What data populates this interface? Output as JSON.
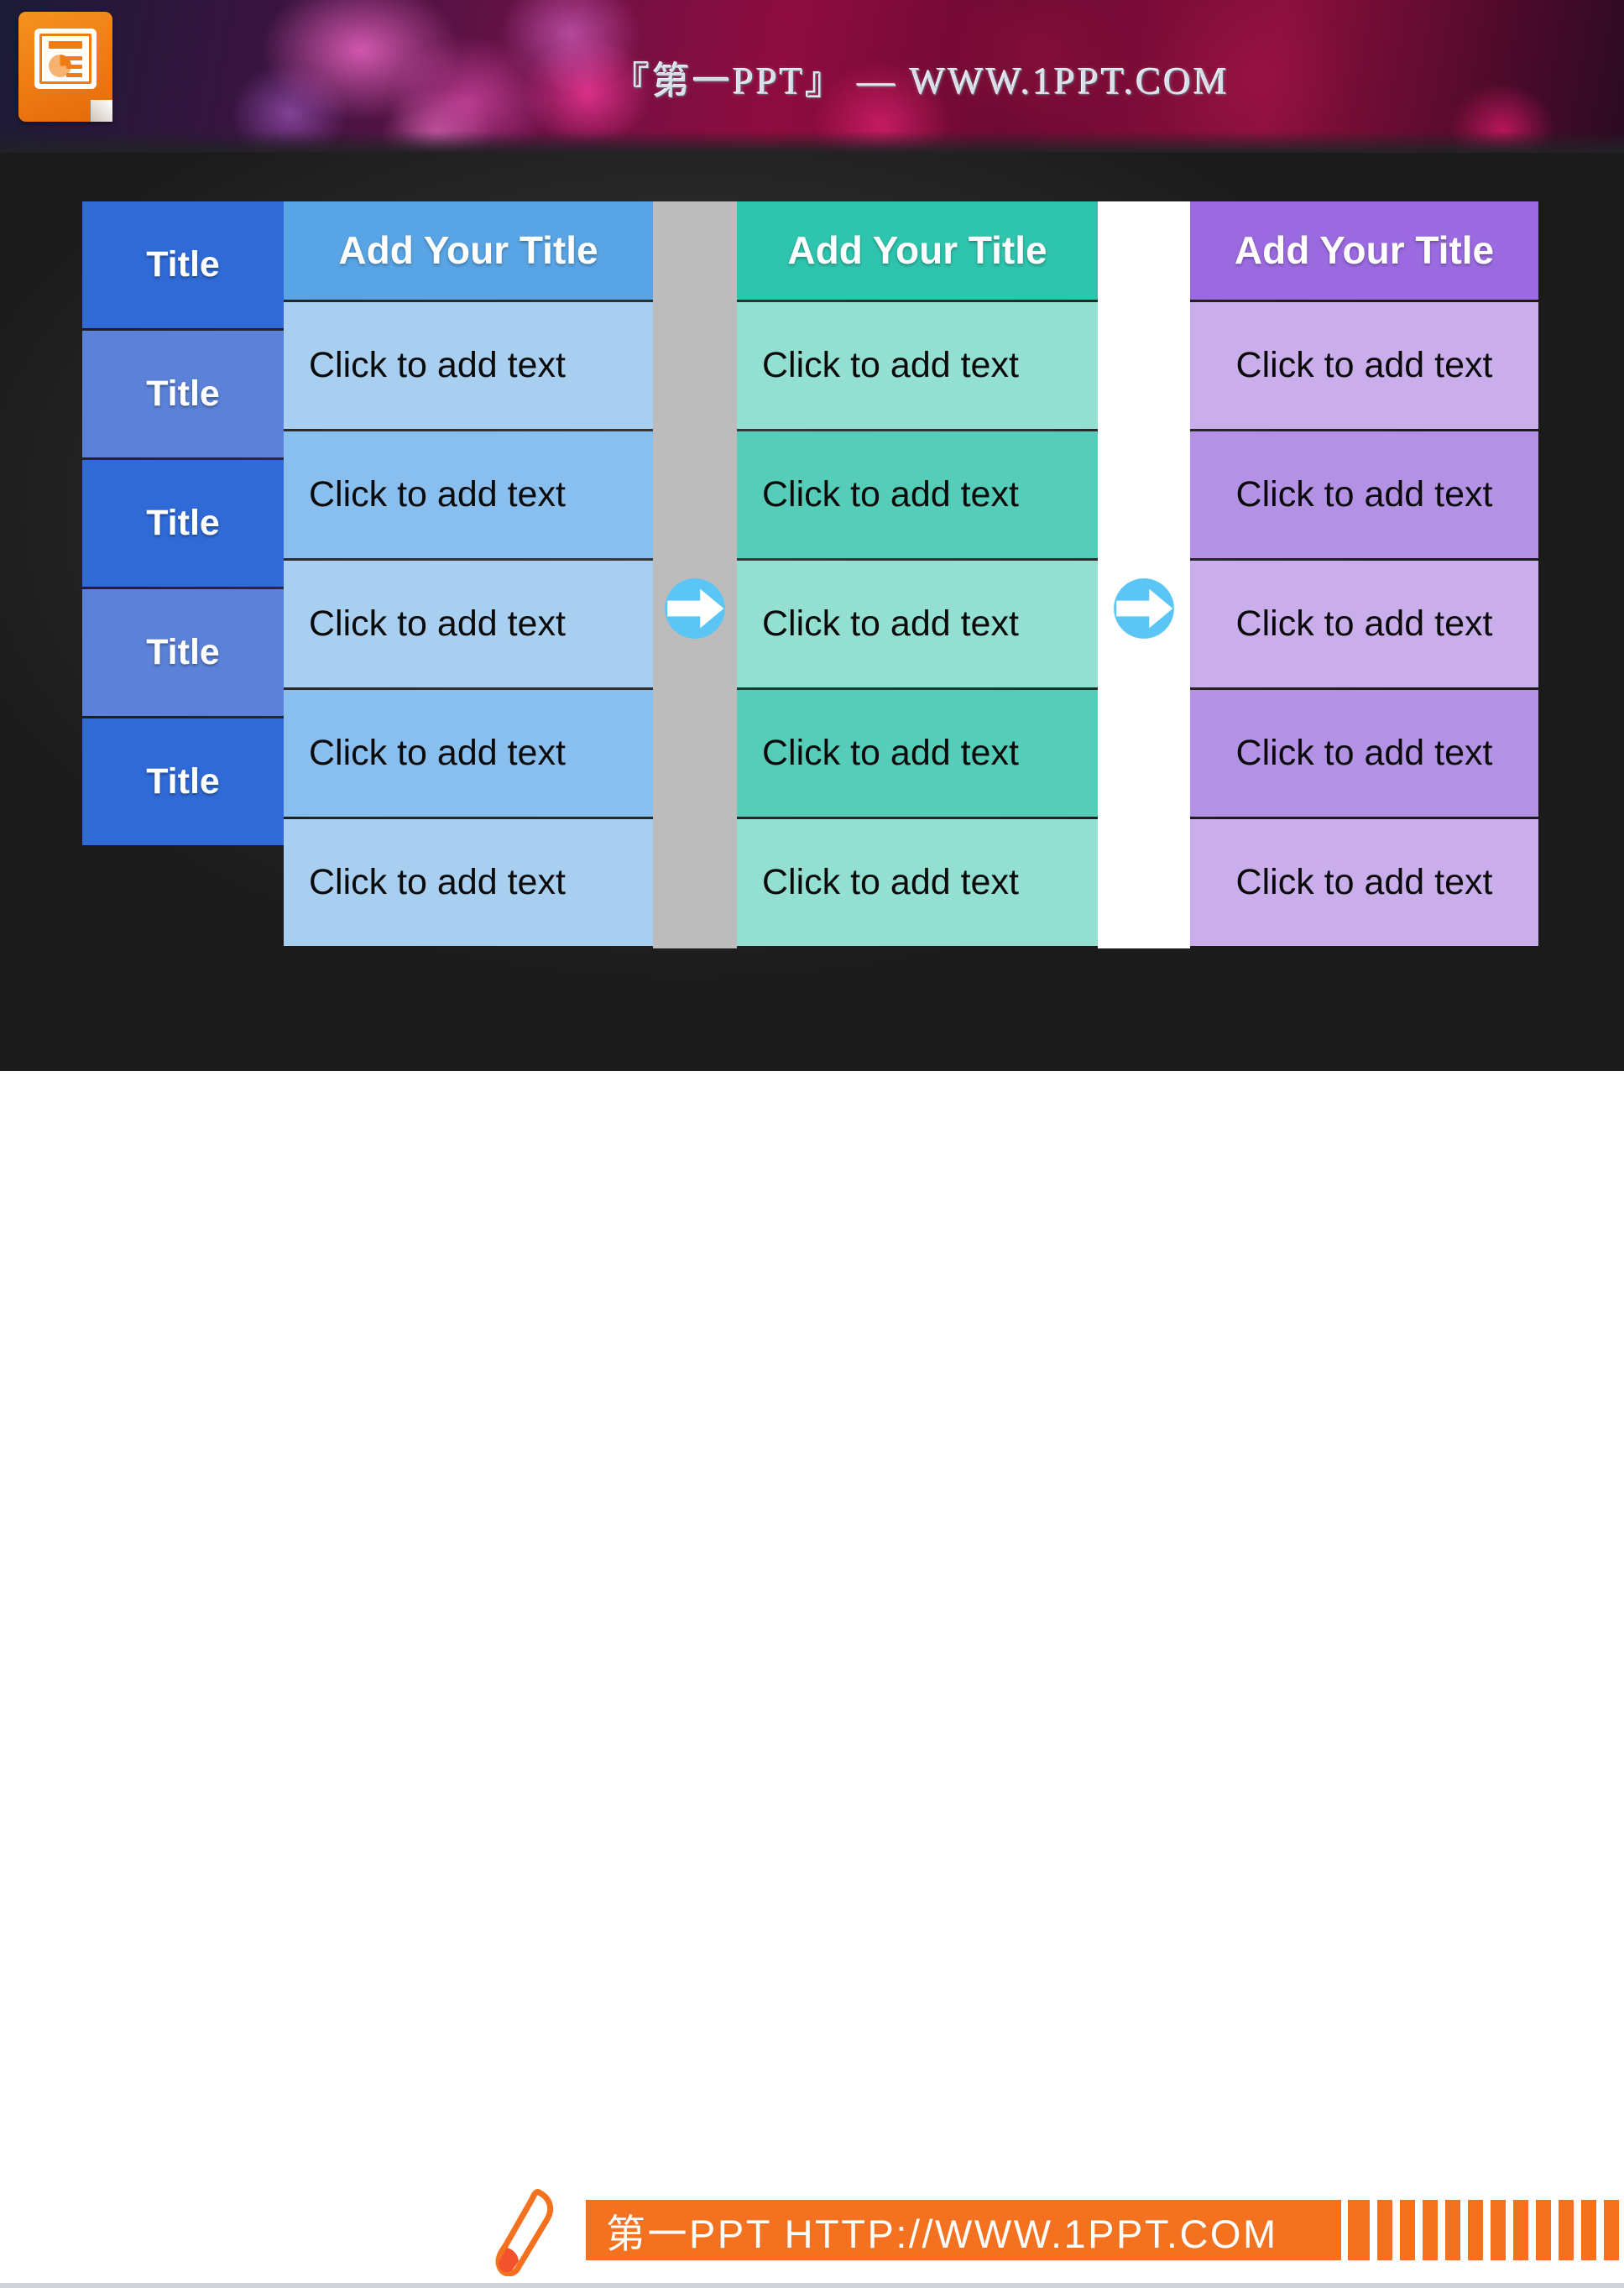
{
  "banner": {
    "brand_text": "『第一PPT』 — WWW.1PPT.COM",
    "logo_icon": "powerpoint-logo-icon"
  },
  "slide": {
    "background_color": "#2e2e2e",
    "arrow_icon": "circle-right-arrow-icon",
    "arrow_color": "#5bc5f5",
    "columns": [
      {
        "id": "row-title",
        "kind": "row-header",
        "header": "",
        "cells": [
          "Title",
          "Title",
          "Title",
          "Title",
          "Title"
        ],
        "colors": {
          "odd": "#2f6ad6",
          "even": "#5b82d8",
          "header": "transparent"
        }
      },
      {
        "id": "blue",
        "kind": "data",
        "header": "Add Your Title",
        "cells": [
          "Click to add text",
          "Click to add text",
          "Click to add text",
          "Click to add text",
          "Click to add text"
        ],
        "colors": {
          "header": "#58a4e4",
          "odd": "#a8cff0",
          "even": "#89bfee"
        }
      },
      {
        "id": "divider-1",
        "kind": "divider",
        "colors": {
          "fill": "#bcbcbc"
        }
      },
      {
        "id": "teal",
        "kind": "data",
        "header": "Add Your Title",
        "cells": [
          "Click to add text",
          "Click to add text",
          "Click to add text",
          "Click to add text",
          "Click to add text"
        ],
        "colors": {
          "header": "#2ec4ad",
          "odd": "#93dfd1",
          "even": "#55cdb9"
        }
      },
      {
        "id": "divider-2",
        "kind": "divider",
        "colors": {
          "fill": "#ffffff"
        }
      },
      {
        "id": "purple",
        "kind": "data",
        "header": "Add Your Title",
        "cells": [
          "Click to add text",
          "Click to add text",
          "Click to add text",
          "Click to add text",
          "Click to add text"
        ],
        "colors": {
          "header": "#9b6ae0",
          "odd": "#c9aeeb",
          "even": "#b392e6"
        }
      }
    ]
  },
  "footer": {
    "text": "第一PPT HTTP://WWW.1PPT.COM",
    "accent_color": "#f4711f",
    "pen_icon": "pen-icon",
    "barcode_icon": "barcode-bars-icon",
    "bar_count": 12
  }
}
